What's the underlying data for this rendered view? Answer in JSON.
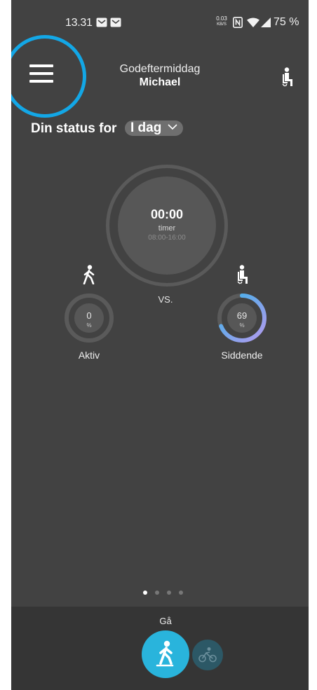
{
  "status_bar": {
    "time": "13.31",
    "net_speed_value": "0.03",
    "net_speed_unit": "KB/S",
    "battery": "75 %"
  },
  "header": {
    "greeting": "Godeftermiddag",
    "user_name": "Michael"
  },
  "status": {
    "heading": "Din status for",
    "period": "I dag"
  },
  "main_timer": {
    "time": "00:00",
    "unit": "timer",
    "hours": "08:00-16:00"
  },
  "comparison": {
    "vs_label": "VS.",
    "active": {
      "value": "0",
      "unit": "%",
      "label": "Aktiv",
      "progress": 0
    },
    "sitting": {
      "value": "69",
      "unit": "%",
      "label": "Siddende",
      "progress": 0.69
    }
  },
  "pager": {
    "count": 4,
    "active_index": 0
  },
  "bottom_bar": {
    "mode_label": "Gå",
    "modes": [
      {
        "icon": "walk-icon",
        "selected": true
      },
      {
        "icon": "bike-icon",
        "selected": false
      }
    ]
  },
  "colors": {
    "background": "#424242",
    "accent": "#13a7e6",
    "walk_button": "#29b4dc",
    "gauge_gradient_start": "#b49aee",
    "gauge_gradient_end": "#36b3e8"
  }
}
